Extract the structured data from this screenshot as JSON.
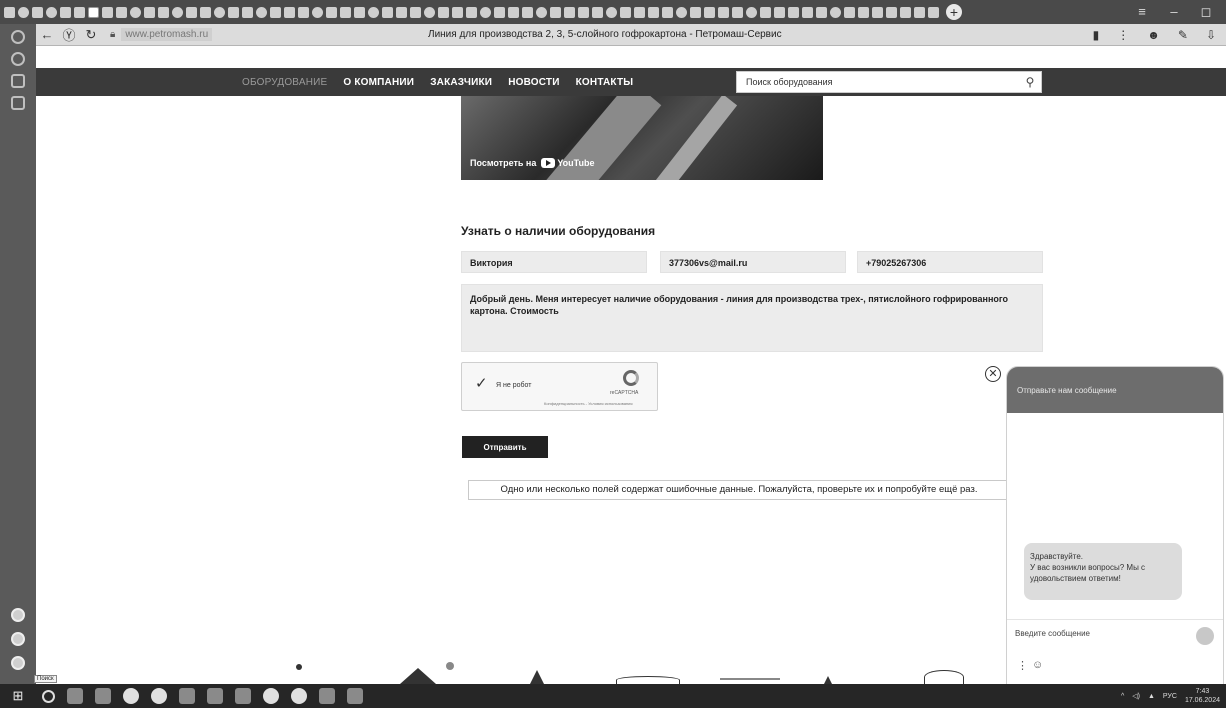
{
  "browser": {
    "title": "Линия для производства 2, 3, 5-слойного гофрокартона - Петромаш-Сервис",
    "url": "www.petromash.ru",
    "back_icon": "back-arrow-icon",
    "reload_icon": "reload-icon"
  },
  "site_nav": {
    "items": [
      "ОБОРУДОВАНИЕ",
      "О КОМПАНИИ",
      "ЗАКАЗЧИКИ",
      "НОВОСТИ",
      "КОНТАКТЫ"
    ]
  },
  "search": {
    "placeholder": "Поиск оборудования"
  },
  "video": {
    "watch_on": "Посмотреть на",
    "brand": "YouTube"
  },
  "form": {
    "heading": "Узнать о наличии оборудования",
    "name_value": "Виктория",
    "email_value": "377306vs@mail.ru",
    "phone_value": "+79025267306",
    "message_value": "Добрый день. Меня интересует наличие оборудования - линия для производства трех-, пятислойного гофрированного картона. Стоимость",
    "captcha_label": "Я не робот",
    "captcha_brand": "reCAPTCHA",
    "captcha_links": "Конфиденциальность - Условия использования",
    "submit_label": "Отправить",
    "error_message": "Одно или несколько полей содержат ошибочные данные. Пожалуйста, проверьте их и попробуйте ещё раз."
  },
  "chat": {
    "header": "Отправьте нам сообщение",
    "greeting_line1": "Здравствуйте.",
    "greeting_line2": "У вас возникли вопросы? Мы с удовольствием ответим!",
    "input_placeholder": "Введите сообщение"
  },
  "taskbar": {
    "search_tooltip": "Поиск",
    "language": "РУС",
    "time": "7:43",
    "date": "17.06.2024"
  }
}
